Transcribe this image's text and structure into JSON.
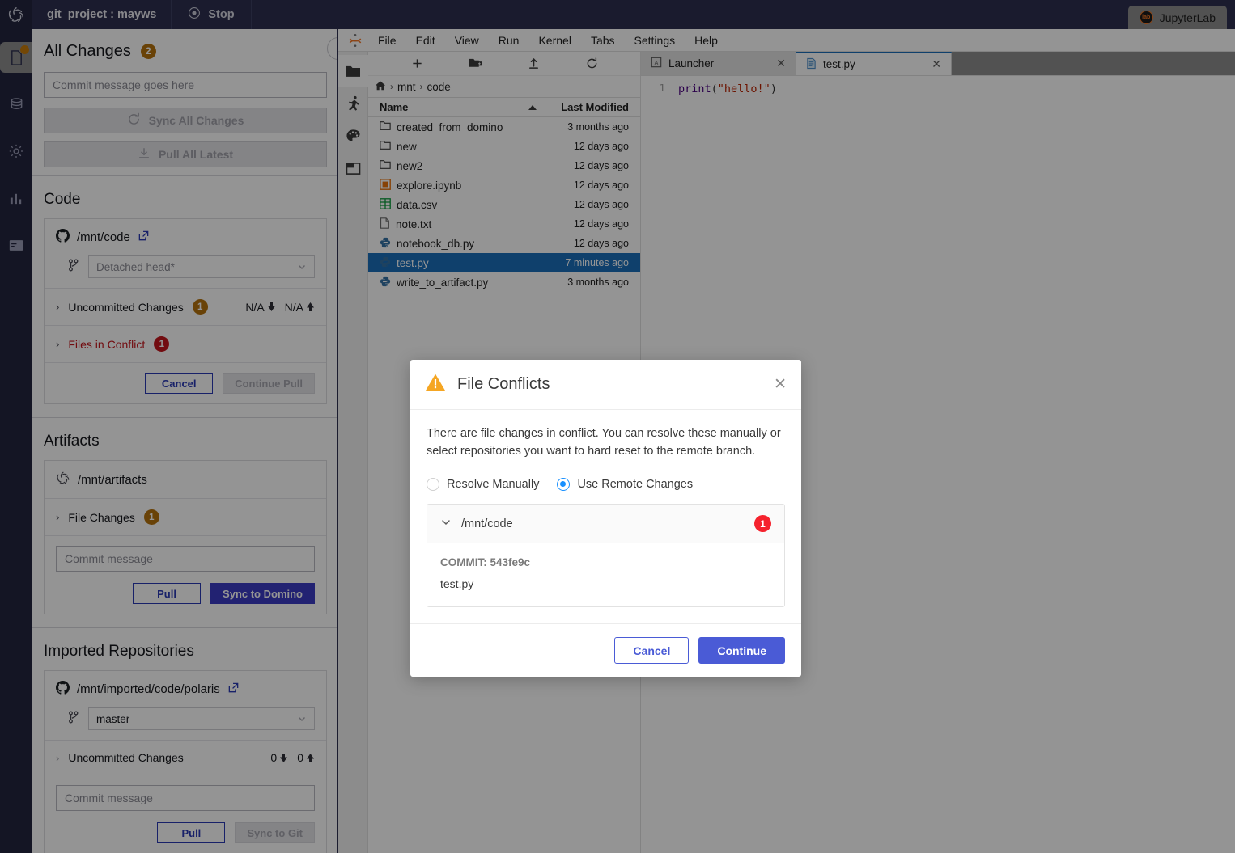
{
  "topbar": {
    "project_title": "git_project : mayws",
    "stop_label": "Stop",
    "jupyterlab_label": "JupyterLab"
  },
  "rail": {
    "items": [
      {
        "name": "files-icon",
        "badge": true
      },
      {
        "name": "database-icon",
        "badge": false
      },
      {
        "name": "gear-icon",
        "badge": false
      },
      {
        "name": "chart-icon",
        "badge": false
      },
      {
        "name": "card-icon",
        "badge": false
      }
    ]
  },
  "domino_panel": {
    "header": {
      "title": "All Changes",
      "count": "2"
    },
    "commit_placeholder": "Commit message goes here",
    "sync_all_label": "Sync All Changes",
    "pull_all_label": "Pull All Latest",
    "code": {
      "section_title": "Code",
      "repo_path": "/mnt/code",
      "branch": "Detached head*",
      "uncommitted_label": "Uncommitted Changes",
      "uncommitted_count": "1",
      "behind": "N/A",
      "ahead": "N/A",
      "conflict_label": "Files in Conflict",
      "conflict_count": "1",
      "cancel_label": "Cancel",
      "continue_pull_label": "Continue Pull"
    },
    "artifacts": {
      "section_title": "Artifacts",
      "repo_path": "/mnt/artifacts",
      "file_changes_label": "File Changes",
      "file_changes_count": "1",
      "commit_placeholder": "Commit message",
      "pull_label": "Pull",
      "sync_label": "Sync to Domino"
    },
    "imported": {
      "section_title": "Imported Repositories",
      "repo_path": "/mnt/imported/code/polaris",
      "branch": "master",
      "uncommitted_label": "Uncommitted Changes",
      "behind": "0",
      "ahead": "0",
      "commit_placeholder": "Commit message",
      "pull_label": "Pull",
      "sync_label": "Sync to Git"
    }
  },
  "jupyterlab": {
    "menus": [
      "File",
      "Edit",
      "View",
      "Run",
      "Kernel",
      "Tabs",
      "Settings",
      "Help"
    ],
    "toolbar_icons": [
      "new-launcher-icon",
      "new-folder-icon",
      "upload-icon",
      "refresh-icon"
    ],
    "breadcrumb": [
      "mnt",
      "code"
    ],
    "columns": {
      "name": "Name",
      "modified": "Last Modified"
    },
    "files": [
      {
        "name": "created_from_domino",
        "modified": "3 months ago",
        "type": "folder",
        "selected": false
      },
      {
        "name": "new",
        "modified": "12 days ago",
        "type": "folder",
        "selected": false
      },
      {
        "name": "new2",
        "modified": "12 days ago",
        "type": "folder",
        "selected": false
      },
      {
        "name": "explore.ipynb",
        "modified": "12 days ago",
        "type": "notebook",
        "selected": false
      },
      {
        "name": "data.csv",
        "modified": "12 days ago",
        "type": "csv",
        "selected": false
      },
      {
        "name": "note.txt",
        "modified": "12 days ago",
        "type": "text",
        "selected": false
      },
      {
        "name": "notebook_db.py",
        "modified": "12 days ago",
        "type": "python",
        "selected": false
      },
      {
        "name": "test.py",
        "modified": "7 minutes ago",
        "type": "python",
        "selected": true
      },
      {
        "name": "write_to_artifact.py",
        "modified": "3 months ago",
        "type": "python",
        "selected": false
      }
    ],
    "editor_tabs": [
      {
        "label": "Launcher",
        "active": false
      },
      {
        "label": "test.py",
        "active": true
      }
    ],
    "editor": {
      "line_number": "1",
      "code_fn": "print",
      "code_open": "(",
      "code_str": "\"hello!\"",
      "code_close": ")"
    }
  },
  "modal": {
    "title": "File Conflicts",
    "description": "There are file changes in conflict. You can resolve these manually or select repositories you want to hard reset to the remote branch.",
    "options": [
      {
        "label": "Resolve Manually",
        "selected": false
      },
      {
        "label": "Use Remote Changes",
        "selected": true
      }
    ],
    "repo": {
      "path": "/mnt/code",
      "count": "1",
      "commit_label": "COMMIT: 543fe9c",
      "files": [
        "test.py"
      ]
    },
    "cancel_label": "Cancel",
    "continue_label": "Continue"
  },
  "colors": {
    "topbar_bg": "#2e3050",
    "accent_blue": "#3b3bc4",
    "radio_blue": "#1890ff",
    "badge_amber": "#b5730d",
    "badge_red": "#c4161c",
    "selection_blue": "#1a6fbb",
    "warning_amber": "#f5a623"
  }
}
